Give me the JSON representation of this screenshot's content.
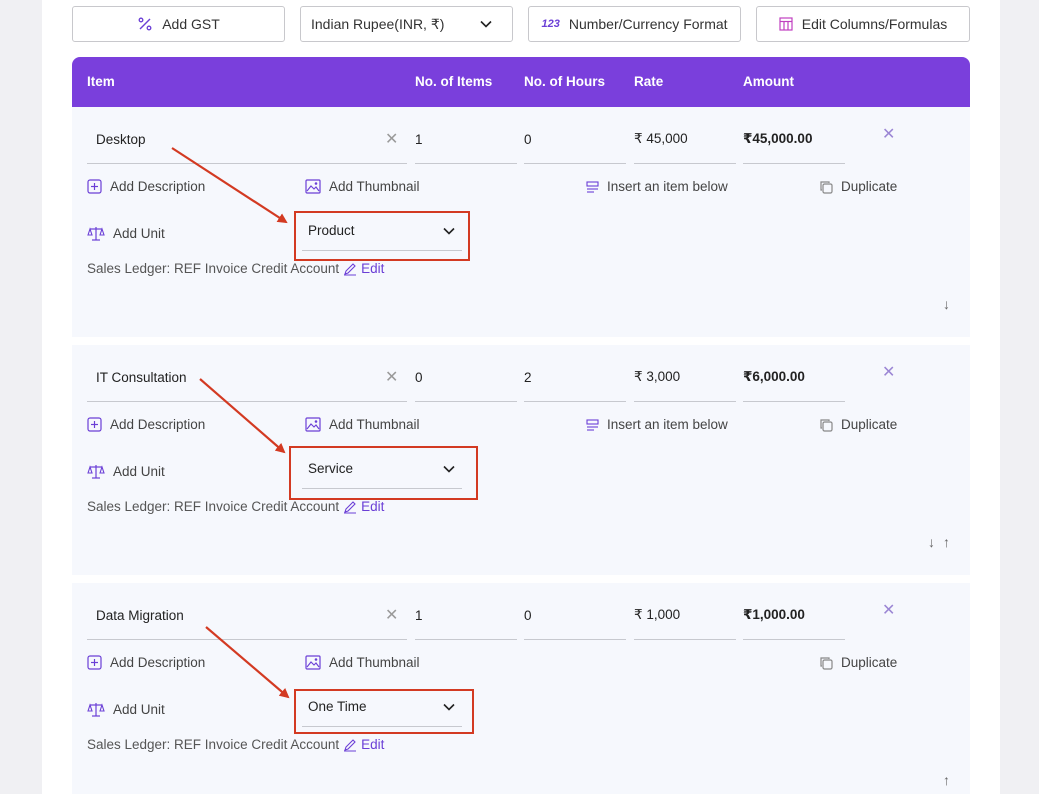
{
  "toolbar": {
    "add_gst": "Add GST",
    "currency": "Indian Rupee(INR, ₹)",
    "number_format": "Number/Currency Format",
    "number_format_badge": "123",
    "edit_columns": "Edit Columns/Formulas"
  },
  "columns": {
    "item": "Item",
    "no_items": "No. of Items",
    "no_hours": "No. of Hours",
    "rate": "Rate",
    "amount": "Amount"
  },
  "actions": {
    "add_description": "Add Description",
    "add_thumbnail": "Add Thumbnail",
    "insert_below": "Insert an item below",
    "duplicate": "Duplicate",
    "add_unit": "Add Unit",
    "ledger": "Sales Ledger: REF Invoice Credit Account",
    "edit": "Edit"
  },
  "items": [
    {
      "name": "Desktop",
      "items": "1",
      "hours": "0",
      "rate": "₹ 45,000",
      "amount": "₹45,000.00",
      "unit": "Product"
    },
    {
      "name": "IT Consultation",
      "items": "0",
      "hours": "2",
      "rate": "₹ 3,000",
      "amount": "₹6,000.00",
      "unit": "Service"
    },
    {
      "name": "Data Migration",
      "items": "1",
      "hours": "0",
      "rate": "₹ 1,000",
      "amount": "₹1,000.00",
      "unit": "One Time"
    }
  ],
  "colors": {
    "header": "#7a3fdc",
    "highlight": "#d33a22",
    "card": "#f6f8fd",
    "accent": "#6b3fd6"
  }
}
